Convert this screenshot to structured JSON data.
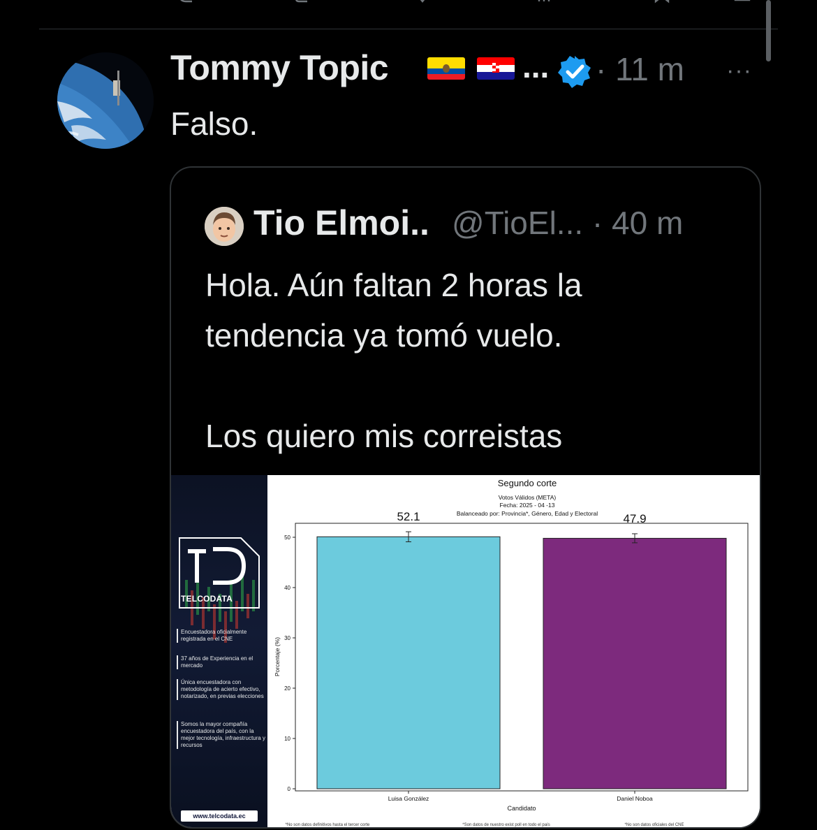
{
  "tweet": {
    "author_name": "Tommy Topic",
    "name_ellipsis": "...",
    "time": "· 11 m",
    "more": "···",
    "text": "Falso."
  },
  "quote": {
    "author_name": "Tio Elmoi..",
    "handle_time": "@TioEl... · 40 m",
    "lines": [
      "Hola. Aún faltan 2 horas la",
      "tendencia ya tomó vuelo.",
      "",
      "Los quiero mis correistas"
    ]
  },
  "media": {
    "brand": "TELCODATA",
    "features": [
      "Encuestadora oficialmente registrada en el CNE",
      "37 años de Experiencia en el mercado",
      "Única encuestadora con metodología de acierto efectivo, notarizado, en previas elecciones",
      "Somos la mayor compañía encuestadora del país, con la mejor tecnología, infraestructura y recursos"
    ],
    "website": "www.telcodata.ec",
    "footnotes": [
      "*No son datos definitivos hasta el tercer corte",
      "*Son datos de nuestro exist poll en todo el país",
      "*No son datos oficiales del CNE"
    ]
  },
  "chart_data": {
    "type": "bar",
    "title": "Segundo corte",
    "subtitle_lines": [
      "Votos Válidos (META)",
      "Fecha: 2025 - 04 -13",
      "Balanceado por: Provincia*, Género, Edad y Electoral"
    ],
    "xlabel": "Candidato",
    "ylabel": "Porcentaje (%)",
    "categories": [
      "Luisa González",
      "Daniel Noboa"
    ],
    "values": [
      50.1,
      49.8
    ],
    "data_labels": [
      "52.1",
      "47.9"
    ],
    "error": [
      1.0,
      0.9
    ],
    "colors": [
      "#6ccbdd",
      "#7d2a7d"
    ],
    "ylim": [
      0,
      60
    ],
    "yticks": [
      0,
      10,
      20,
      30,
      40,
      50
    ]
  },
  "colors": {
    "background": "#000000",
    "text_primary": "#e7e9ea",
    "text_secondary": "#71767b",
    "verified": "#1d9bf0",
    "border": "#2f3336"
  },
  "icons": [
    "reply-icon",
    "retweet-icon",
    "like-icon",
    "views-icon",
    "bookmark-icon",
    "share-icon",
    "verified-badge-icon",
    "ecuador-flag-icon",
    "croatia-flag-icon",
    "more-icon"
  ]
}
